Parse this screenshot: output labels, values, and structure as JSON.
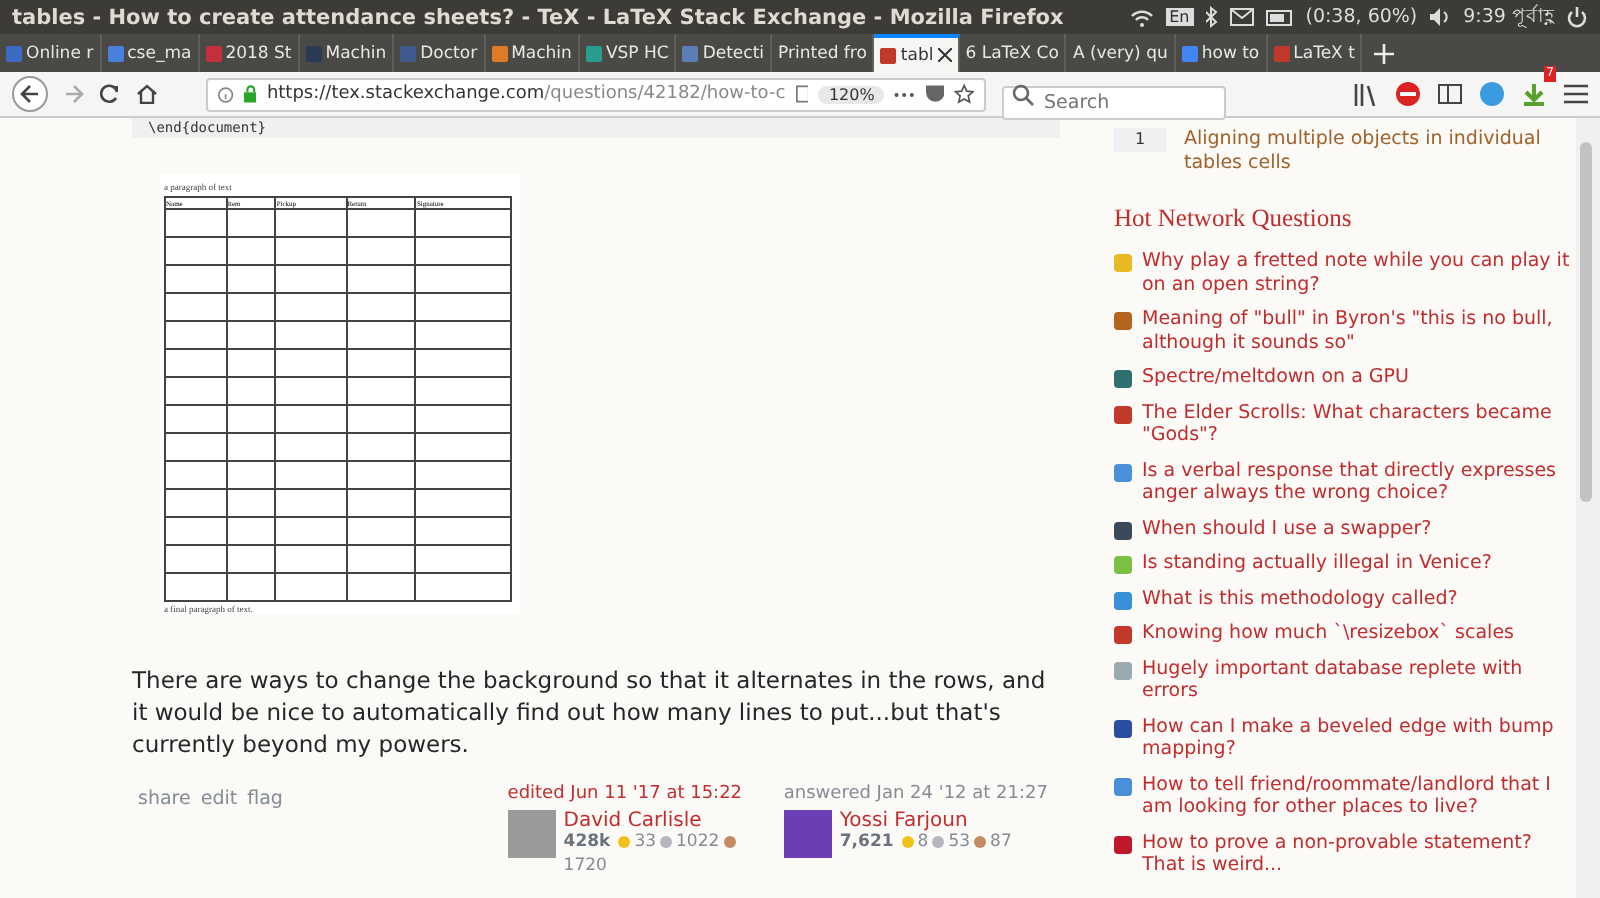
{
  "window": {
    "title": "tables - How to create attendance sheets? - TeX - LaTeX Stack Exchange - Mozilla Firefox"
  },
  "system_tray": {
    "keyboard": "En",
    "battery": "(0:38, 60%)",
    "clock": "9:39 পূর্বাহ্ণ"
  },
  "tabs": [
    {
      "label": "Online r",
      "selected": false,
      "color": "#3d6bc4"
    },
    {
      "label": "cse_ma",
      "selected": false,
      "color": "#4a7fe0"
    },
    {
      "label": "2018 St",
      "selected": false,
      "color": "#c4313b"
    },
    {
      "label": "Machin",
      "selected": false,
      "color": "#2b3a55"
    },
    {
      "label": "Doctor",
      "selected": false,
      "color": "#3f5a8f"
    },
    {
      "label": "Machin",
      "selected": false,
      "color": "#e07b2a"
    },
    {
      "label": "VSP HC",
      "selected": false,
      "color": "#2a9d8f"
    },
    {
      "label": "Detecti",
      "selected": false,
      "color": "#5b7fb5"
    },
    {
      "label": "Printed fro",
      "selected": false
    },
    {
      "label": "tabl",
      "selected": true,
      "color": "#c0392b"
    },
    {
      "label": "6 LaTeX Co",
      "selected": false
    },
    {
      "label": "A (very) qu",
      "selected": false
    },
    {
      "label": "how to",
      "selected": false,
      "color": "#4285f4"
    },
    {
      "label": "LaTeX t",
      "selected": false,
      "color": "#c0392b"
    }
  ],
  "nav": {
    "url_host": "https://tex.stackexchange.com",
    "url_path": "/questions/42182/how-to-c",
    "zoom": "120%",
    "search_placeholder": "Search",
    "notification_count": "7"
  },
  "post": {
    "code_tail": "\\end{document}",
    "document": {
      "intro": "a paragraph of text",
      "columns": [
        "Name",
        "Item",
        "Pickup",
        "Return",
        "Signature"
      ],
      "outro": "a final paragraph of text."
    },
    "text": "There are ways to change the background so that it alternates in the rows, and it would be nice to automatically find out how many lines to put...but that's currently beyond my powers.",
    "actions": [
      "share",
      "edit",
      "flag"
    ],
    "signatures": [
      {
        "action": "edited Jun 11 '17 at 15:22",
        "highlight": true,
        "name": "David Carlisle",
        "reputation": "428k",
        "badges": [
          {
            "kind": "gold",
            "count": "33"
          },
          {
            "kind": "silver",
            "count": "1022"
          },
          {
            "kind": "bronze",
            "count": "1720"
          }
        ]
      },
      {
        "action": "answered Jan 24 '12 at 21:27",
        "highlight": false,
        "name": "Yossi Farjoun",
        "reputation": "7,621",
        "badges": [
          {
            "kind": "gold",
            "count": "8"
          },
          {
            "kind": "silver",
            "count": "53"
          },
          {
            "kind": "bronze",
            "count": "87"
          }
        ]
      }
    ]
  },
  "sidebar": {
    "linked": [
      {
        "votes": "1",
        "title": "Aligning multiple objects in individual tables cells"
      }
    ],
    "hot_title": "Hot Network Questions",
    "hot": [
      {
        "title": "Why play a fretted note while you can play it on an open string?",
        "color": "#e8b923"
      },
      {
        "title": "Meaning of \"bull\" in Byron's \"this is no bull, although it sounds so\"",
        "color": "#b5651d"
      },
      {
        "title": "Spectre/meltdown on a GPU",
        "color": "#2f6f6f"
      },
      {
        "title": "The Elder Scrolls: What characters became \"Gods\"?",
        "color": "#c0392b"
      },
      {
        "title": "Is a verbal response that directly expresses anger always the wrong choice?",
        "color": "#4a90d9"
      },
      {
        "title": "When should I use a swapper?",
        "color": "#3a4a5a"
      },
      {
        "title": "Is standing actually illegal in Venice?",
        "color": "#7bc043"
      },
      {
        "title": "What is this methodology called?",
        "color": "#3a8fd9"
      },
      {
        "title": "Knowing how much `\\resizebox` scales",
        "color": "#c0392b"
      },
      {
        "title": "Hugely important database replete with errors",
        "color": "#9aaab0"
      },
      {
        "title": "How can I make a beveled edge with bump mapping?",
        "color": "#2a4ea0"
      },
      {
        "title": "How to tell friend/roommate/landlord that I am looking for other places to live?",
        "color": "#4a90d9"
      },
      {
        "title": "How to prove a non-provable statement? That is weird...",
        "color": "#c0182b"
      }
    ]
  }
}
